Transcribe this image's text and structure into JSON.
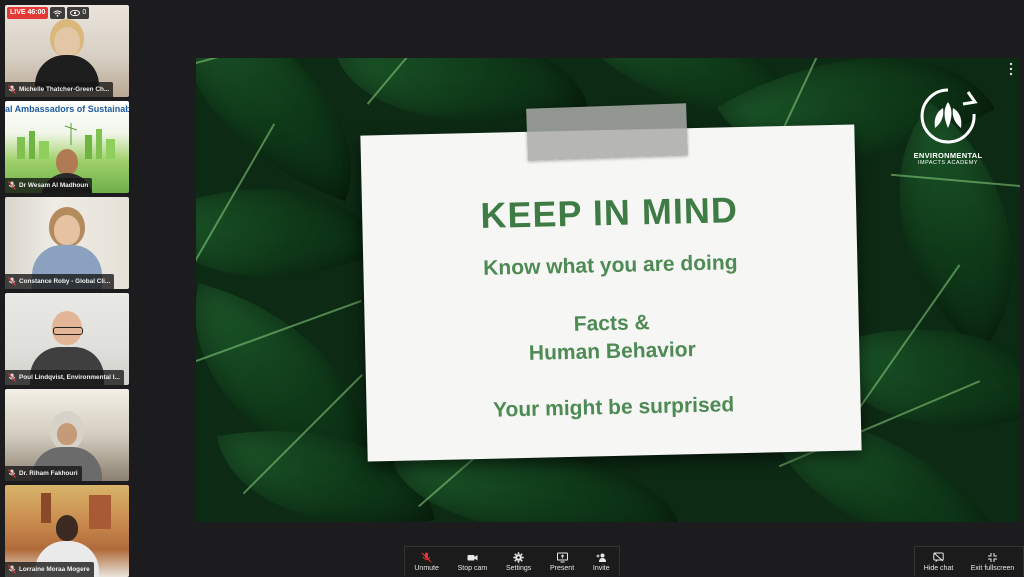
{
  "live": {
    "badge": "LIVE 46:00",
    "viewer_count": "0"
  },
  "participants": [
    {
      "name": "Michelle Thatcher-Green Ch..."
    },
    {
      "name": "Dr Wesam Al Madhoun",
      "banner": "al Ambassadors of Sustainab"
    },
    {
      "name": "Constance Roby - Global Cli..."
    },
    {
      "name": "Poul Lindqvist, Environmental I..."
    },
    {
      "name": "Dr. Riham Fakhouri"
    },
    {
      "name": "Lorraine Moraa Mogere"
    }
  ],
  "slide": {
    "title": "KEEP IN MIND",
    "lines": [
      "Know what you are doing",
      "Facts &",
      "Human Behavior",
      "Your might be surprised"
    ],
    "brand_name": "ENVIRONMENTAL",
    "brand_sub": "IMPACTS ACADEMY"
  },
  "toolbar": {
    "unmute": "Unmute",
    "stop_cam": "Stop cam",
    "settings": "Settings",
    "present": "Present",
    "invite": "Invite",
    "hide_chat": "Hide chat",
    "exit_fullscreen": "Exit fullscreen"
  },
  "colors": {
    "live": "#e53935",
    "mic_muted": "#e53935",
    "slide_text": "#3e7b45"
  }
}
